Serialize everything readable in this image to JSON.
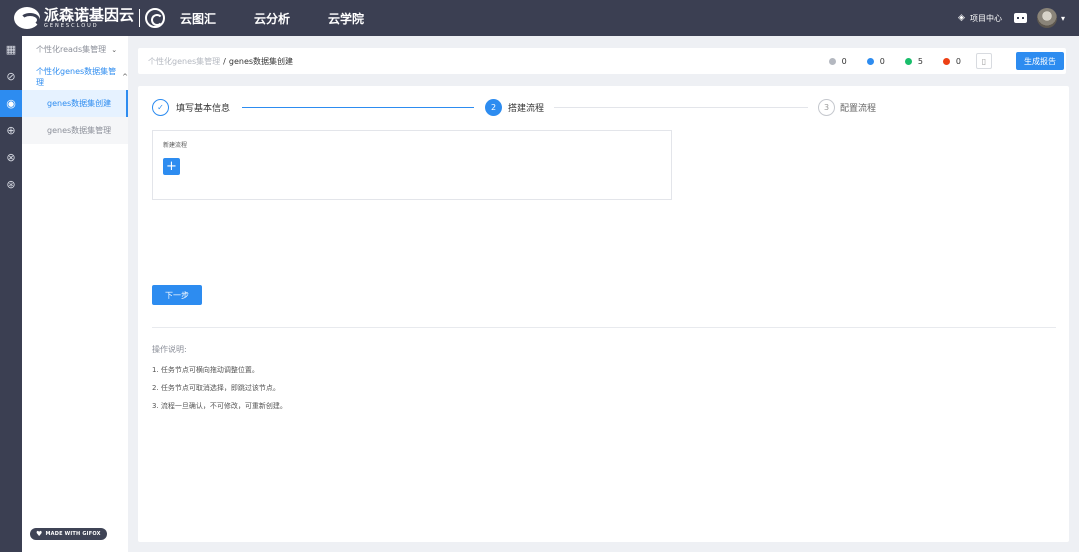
{
  "header": {
    "logo_text": "派森诺基因云",
    "logo_sub": "GENESCLOUD",
    "nav": [
      "云图汇",
      "云分析",
      "云学院"
    ],
    "project_center": "项目中心"
  },
  "sidebar": {
    "groups": [
      {
        "label": "个性化reads集管理",
        "caret": "⌄",
        "open": false
      },
      {
        "label": "个性化genes数据集管理",
        "caret": "^",
        "open": true
      }
    ],
    "items": [
      {
        "label": "genes数据集创建",
        "active": true
      },
      {
        "label": "genes数据集管理",
        "active": false
      }
    ],
    "made_with": "MADE WITH GIFOX"
  },
  "breadcrumb": {
    "parent": "个性化genes集管理",
    "separator": "/",
    "current": "genes数据集创建"
  },
  "stats": [
    {
      "value": "0",
      "color": "#b4b8c0"
    },
    {
      "value": "0",
      "color": "#2d8cf0"
    },
    {
      "value": "5",
      "color": "#19be6b"
    },
    {
      "value": "0",
      "color": "#ed4014"
    }
  ],
  "report_button": "生成报告",
  "steps": [
    {
      "index": "✓",
      "label": "填写基本信息",
      "state": "done"
    },
    {
      "index": "2",
      "label": "搭建流程",
      "state": "current"
    },
    {
      "index": "3",
      "label": "配置流程",
      "state": "wait"
    }
  ],
  "flow": {
    "title": "新建流程",
    "add_symbol": "+"
  },
  "next_button": "下一步",
  "notes": {
    "title": "操作说明:",
    "items": [
      "1. 任务节点可横向拖动调整位置。",
      "2. 任务节点可取消选择，即跳过该节点。",
      "3. 流程一旦确认，不可修改，可重新创建。"
    ]
  },
  "colors": {
    "primary": "#2d8cf0",
    "dark": "#3b3f52"
  }
}
